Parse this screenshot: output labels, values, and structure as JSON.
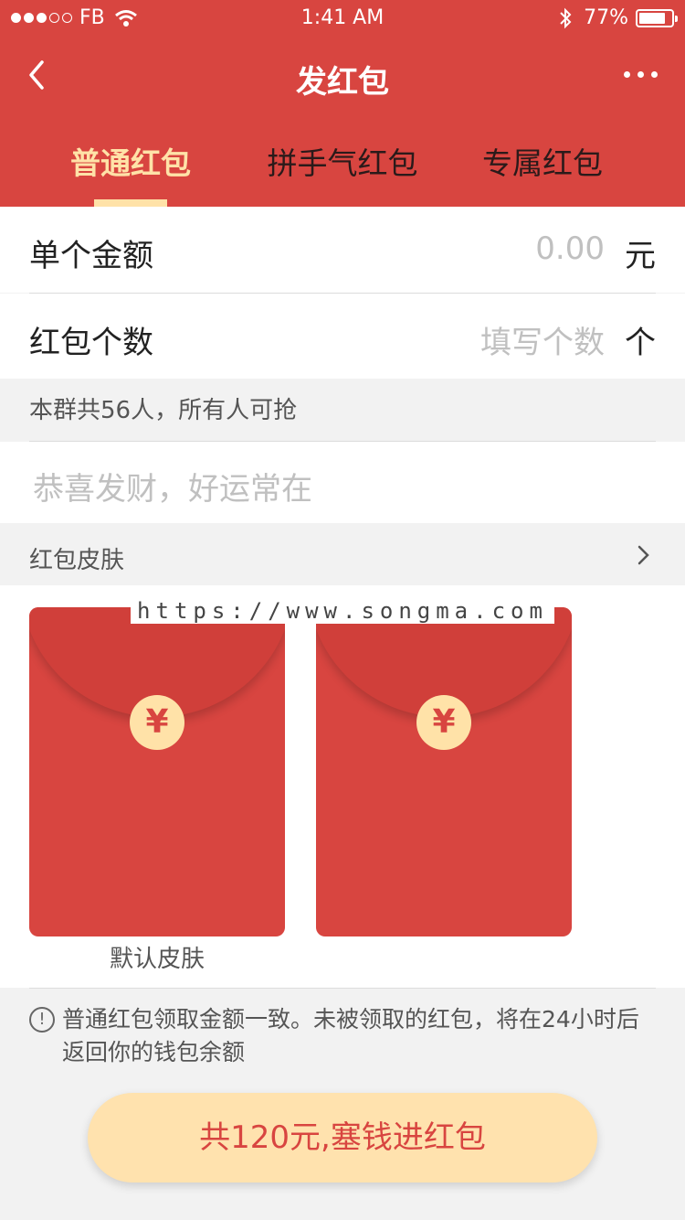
{
  "status_bar": {
    "carrier": "FB",
    "time": "1:41 AM",
    "battery": "77%",
    "battery_level": 0.77
  },
  "nav": {
    "title": "发红包",
    "back_icon": "chevron-left-icon",
    "more_icon": "more-dots-icon"
  },
  "tabs": [
    {
      "label": "普通红包",
      "active": true
    },
    {
      "label": "拼手气红包",
      "active": false
    },
    {
      "label": "专属红包",
      "active": false
    }
  ],
  "form": {
    "amount_label": "单个金额",
    "amount_placeholder": "0.00",
    "amount_unit": "元",
    "count_label": "红包个数",
    "count_placeholder": "填写个数",
    "count_unit": "个",
    "group_info": "本群共56人，所有人可抢",
    "message_placeholder": "恭喜发财，好运常在"
  },
  "skins": {
    "header_label": "红包皮肤",
    "items": [
      {
        "caption": "默认皮肤",
        "symbol": "¥"
      },
      {
        "caption": "",
        "symbol": "¥"
      }
    ],
    "watermark": "https://www.songma.com"
  },
  "notice": {
    "text": "普通红包领取金额一致。未被领取的红包，将在24小时后返回你的钱包余额"
  },
  "submit": {
    "label": "共120元,塞钱进红包"
  },
  "colors": {
    "brand_red": "#d84540",
    "accent_gold": "#ffe2a8"
  }
}
